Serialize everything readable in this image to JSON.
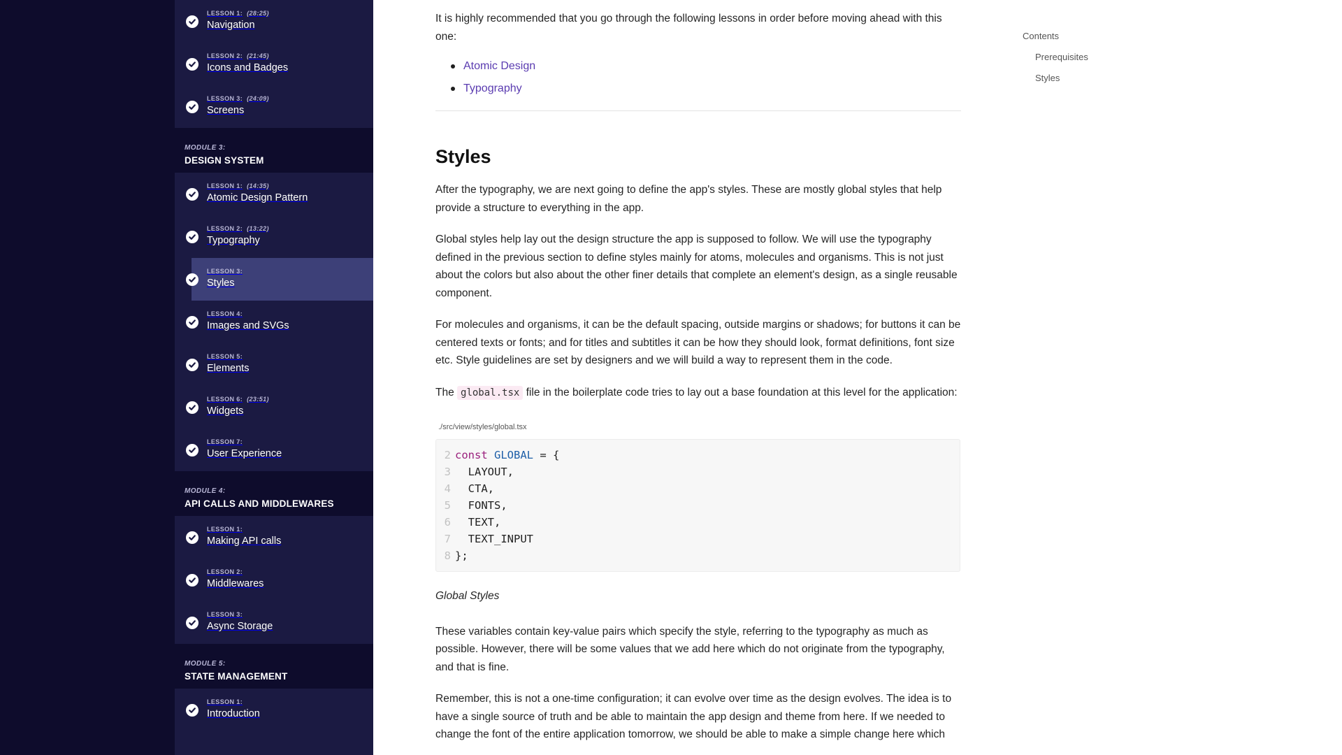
{
  "sidebar": {
    "sections": [
      {
        "type": "lessons",
        "items": [
          {
            "meta": "LESSON 1:",
            "duration": "(28:25)",
            "title": "Navigation",
            "active": false
          },
          {
            "meta": "LESSON 2:",
            "duration": "(21:45)",
            "title": "Icons and Badges",
            "active": false
          },
          {
            "meta": "LESSON 3:",
            "duration": "(24:09)",
            "title": "Screens",
            "active": false
          }
        ]
      },
      {
        "type": "module",
        "label": "MODULE 3:",
        "title": "DESIGN SYSTEM"
      },
      {
        "type": "lessons",
        "items": [
          {
            "meta": "LESSON 1:",
            "duration": "(14:35)",
            "title": "Atomic Design Pattern",
            "active": false
          },
          {
            "meta": "LESSON 2:",
            "duration": "(13:22)",
            "title": "Typography",
            "active": false
          },
          {
            "meta": "LESSON 3:",
            "duration": "",
            "title": "Styles",
            "active": true
          },
          {
            "meta": "LESSON 4:",
            "duration": "",
            "title": "Images and SVGs",
            "active": false
          },
          {
            "meta": "LESSON 5:",
            "duration": "",
            "title": "Elements",
            "active": false
          },
          {
            "meta": "LESSON 6:",
            "duration": "(23:51)",
            "title": "Widgets",
            "active": false
          },
          {
            "meta": "LESSON 7:",
            "duration": "",
            "title": "User Experience",
            "active": false
          }
        ]
      },
      {
        "type": "module",
        "label": "MODULE 4:",
        "title": "API CALLS AND MIDDLEWARES"
      },
      {
        "type": "lessons",
        "items": [
          {
            "meta": "LESSON 1:",
            "duration": "",
            "title": "Making API calls",
            "active": false
          },
          {
            "meta": "LESSON 2:",
            "duration": "",
            "title": "Middlewares",
            "active": false
          },
          {
            "meta": "LESSON 3:",
            "duration": "",
            "title": "Async Storage",
            "active": false
          }
        ]
      },
      {
        "type": "module",
        "label": "MODULE 5:",
        "title": "STATE MANAGEMENT"
      },
      {
        "type": "lessons",
        "items": [
          {
            "meta": "LESSON 1:",
            "duration": "",
            "title": "Introduction",
            "active": false
          }
        ]
      }
    ]
  },
  "content": {
    "prereq_intro": "It is highly recommended that you go through the following lessons in order before moving ahead with this one:",
    "prereq_links": [
      "Atomic Design",
      "Typography"
    ],
    "heading": "Styles",
    "para1": "After the typography, we are next going to define the app's styles. These are mostly global styles that help provide a structure to everything in the app.",
    "para2": "Global styles help lay out the design structure the app is supposed to follow. We will use the typography defined in the previous section to define styles mainly for atoms, molecules and organisms. This is not just about the colors but also about the other finer details that complete an element's design, as a single reusable component.",
    "para3": "For molecules and organisms, it can be the default spacing, outside margins or shadows; for buttons it can be centered texts or fonts; and for titles and subtitles it can be how they should look, format definitions, font size etc. Style guidelines are set by designers and we will build a way to represent them in the code.",
    "para4_before": "The ",
    "para4_code": "global.tsx",
    "para4_after": " file in the boilerplate code tries to lay out a base foundation at this level for the application:",
    "code_path": "./src/view/styles/global.tsx",
    "code_lines": [
      {
        "ln": "2",
        "kw": "const",
        "name": "GLOBAL",
        "rest": " = {"
      },
      {
        "ln": "3",
        "text": "  LAYOUT,"
      },
      {
        "ln": "4",
        "text": "  CTA,"
      },
      {
        "ln": "5",
        "text": "  FONTS,"
      },
      {
        "ln": "6",
        "text": "  TEXT,"
      },
      {
        "ln": "7",
        "text": "  TEXT_INPUT"
      },
      {
        "ln": "8",
        "text": "};"
      }
    ],
    "caption": "Global Styles",
    "para5": "These variables contain key-value pairs which specify the style, referring to the typography as much as possible. However, there will be some values that we add here which do not originate from the typography, and that is fine.",
    "para6": "Remember, this is not a one-time configuration; it can evolve over time as the design evolves. The idea is to have a single source of truth and be able to maintain the app design and theme from here. If we needed to change the font of the entire application tomorrow, we should be able to make a simple change here which"
  },
  "toc": {
    "heading": "Contents",
    "items": [
      "Prerequisites",
      "Styles"
    ]
  },
  "colors": {
    "gutter": "#0e0c2c",
    "sidebar": "#1b1a42",
    "active_lesson": "#3d4078",
    "link": "#5a3bb0"
  },
  "icons": {
    "lesson_status": "check-circle-icon"
  }
}
